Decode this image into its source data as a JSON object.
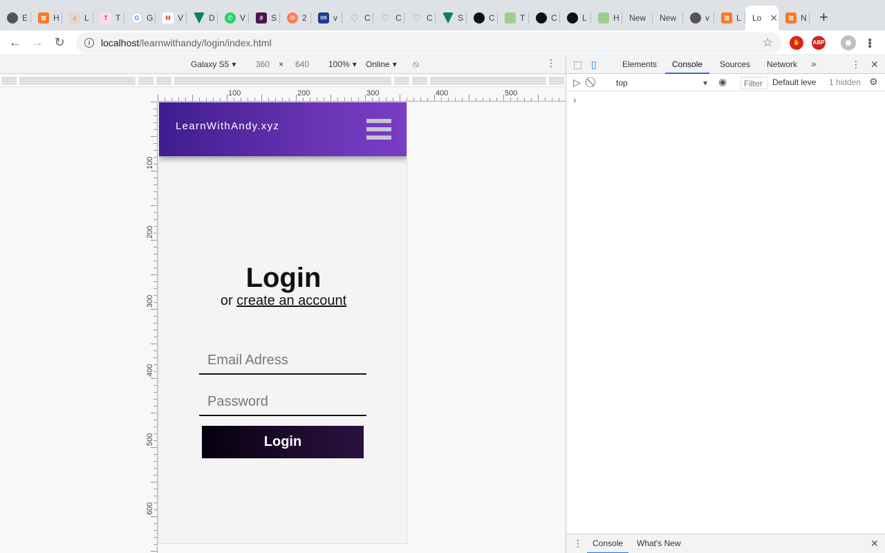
{
  "browser": {
    "tabs": [
      {
        "icon": "globe-icon",
        "cls": "globe",
        "glyph": "",
        "label": "E"
      },
      {
        "icon": "xampp-icon",
        "cls": "xampp",
        "glyph": "⊠",
        "label": "H"
      },
      {
        "icon": "house-icon",
        "cls": "house",
        "glyph": "⌂",
        "label": "L"
      },
      {
        "icon": "tt-icon",
        "cls": "tt",
        "glyph": "T",
        "label": "T"
      },
      {
        "icon": "google-icon",
        "cls": "g",
        "glyph": "G",
        "label": "G"
      },
      {
        "icon": "gmail-icon",
        "cls": "gm",
        "glyph": "M",
        "label": "V"
      },
      {
        "icon": "vue-icon",
        "cls": "vue",
        "glyph": "",
        "label": "D"
      },
      {
        "icon": "whatsapp-icon",
        "cls": "wa",
        "glyph": "✆",
        "label": "V"
      },
      {
        "icon": "slack-icon",
        "cls": "slack",
        "glyph": "#",
        "label": "S"
      },
      {
        "icon": "hubspot-icon",
        "cls": "hub",
        "glyph": "⚙",
        "label": "2"
      },
      {
        "icon": "box-icon",
        "cls": "box",
        "glyph": "G5",
        "label": "v"
      },
      {
        "icon": "heart-icon",
        "cls": "heart",
        "glyph": "♡",
        "label": "C"
      },
      {
        "icon": "heart-icon",
        "cls": "heart",
        "glyph": "♡",
        "label": "C"
      },
      {
        "icon": "heart-icon",
        "cls": "heart",
        "glyph": "♡",
        "label": "C"
      },
      {
        "icon": "vue-icon",
        "cls": "vue",
        "glyph": "",
        "label": "S"
      },
      {
        "icon": "github-icon",
        "cls": "gh",
        "glyph": "",
        "label": "C"
      },
      {
        "icon": "chart-icon",
        "cls": "chart",
        "glyph": "",
        "label": "T"
      },
      {
        "icon": "github-icon",
        "cls": "gh",
        "glyph": "",
        "label": "C"
      },
      {
        "icon": "github-icon",
        "cls": "gh",
        "glyph": "",
        "label": "L"
      },
      {
        "icon": "chart-icon",
        "cls": "chart",
        "glyph": "",
        "label": "H"
      },
      {
        "icon": "",
        "cls": "",
        "glyph": "",
        "label": "New"
      },
      {
        "icon": "",
        "cls": "",
        "glyph": "",
        "label": "New"
      },
      {
        "icon": "globe-icon",
        "cls": "globe",
        "glyph": "",
        "label": "v"
      },
      {
        "icon": "xampp-icon",
        "cls": "xampp",
        "glyph": "⊠",
        "label": "L"
      },
      {
        "icon": "",
        "cls": "",
        "glyph": "",
        "label": "Lo",
        "active": true
      },
      {
        "icon": "xampp-icon",
        "cls": "xampp",
        "glyph": "⊠",
        "label": "N"
      }
    ],
    "url_host": "localhost",
    "url_path": "/learnwithandy/login/index.html"
  },
  "device_toolbar": {
    "device": "Galaxy S5",
    "width": "360",
    "times": "×",
    "height": "640",
    "zoom": "100%",
    "network": "Online"
  },
  "rulers": {
    "h": [
      "100",
      "200",
      "300",
      "400",
      "500"
    ],
    "v": [
      "100",
      "200",
      "300",
      "400",
      "500",
      "600"
    ]
  },
  "site": {
    "brand": "LearnWithAndy.xyz",
    "title": "Login",
    "sub_prefix": "or ",
    "sub_link": "create an account",
    "email_placeholder": "Email Adress",
    "password_placeholder": "Password",
    "button": "Login"
  },
  "devtools": {
    "tabs": [
      "Elements",
      "Console",
      "Sources",
      "Network"
    ],
    "active_tab": "Console",
    "context": "top",
    "filter": "Filter",
    "levels": "Default leve",
    "hidden": "1 hidden",
    "prompt": "›",
    "drawer_tabs": [
      "Console",
      "What's New"
    ]
  }
}
